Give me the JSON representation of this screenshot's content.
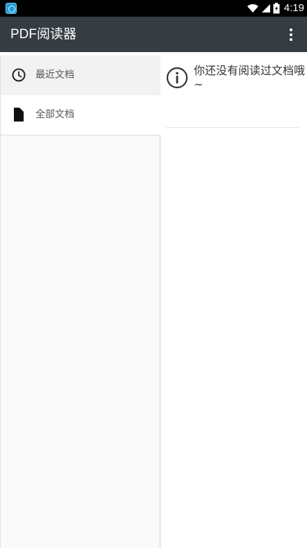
{
  "status_bar": {
    "time": "4:19",
    "icons": [
      "app-notification-icon",
      "wifi-icon",
      "cell-signal-icon",
      "battery-icon"
    ]
  },
  "app_bar": {
    "title": "PDF阅读器",
    "menu_icon": "more-vert-icon"
  },
  "drawer": {
    "items": [
      {
        "label": "最近文档",
        "icon": "clock-icon",
        "selected": true
      },
      {
        "label": "全部文档",
        "icon": "file-icon",
        "selected": false
      }
    ]
  },
  "content": {
    "message": "你还没有阅读过文档哦~",
    "icon": "info-icon"
  },
  "colors": {
    "app_bar": "#353c42",
    "status_bar": "#000000",
    "selected_item": "#f2f2f2",
    "drawer_bg": "#fafafa"
  }
}
